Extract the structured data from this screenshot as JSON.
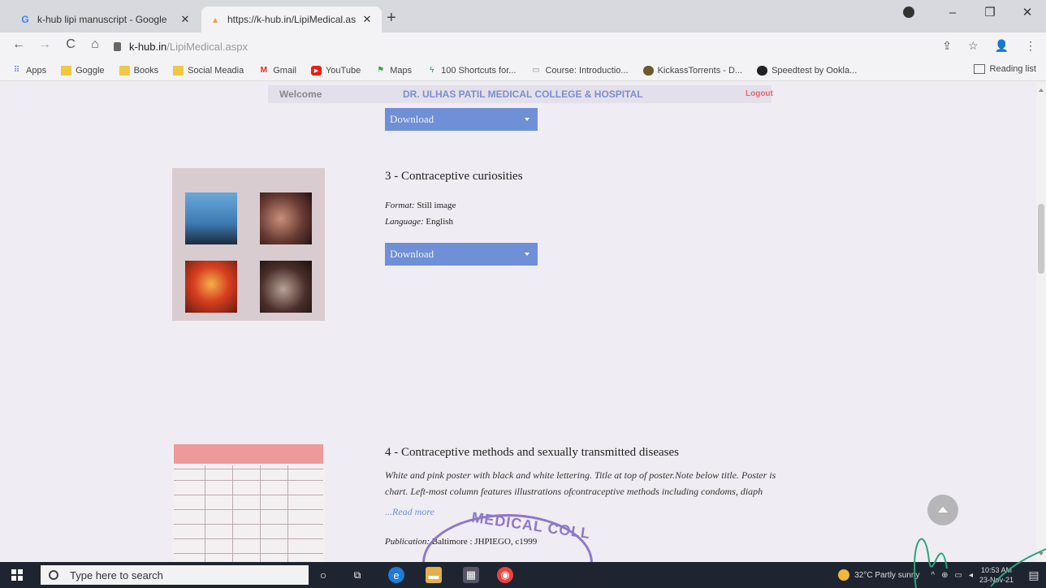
{
  "browser": {
    "tabs": [
      {
        "title": "k-hub lipi manuscript - Google",
        "close": "✕"
      },
      {
        "title": "https://k-hub.in/LipiMedical.aspx",
        "close": "✕"
      }
    ],
    "new_tab": "+",
    "window_controls": {
      "minimize": "–",
      "restore": "❐",
      "close": "✕"
    },
    "nav": {
      "back": "←",
      "forward": "→",
      "reload": "C",
      "home": "⌂"
    },
    "url_host": "k-hub.in",
    "url_path": "/LipiMedical.aspx",
    "toolbar_icons": {
      "share": "⇪",
      "star": "☆",
      "profile": "👤",
      "menu": "⋮"
    },
    "bookmarks": [
      {
        "label": "Apps"
      },
      {
        "label": "Goggle"
      },
      {
        "label": "Books"
      },
      {
        "label": "Social Meadia"
      },
      {
        "label": "Gmail"
      },
      {
        "label": "YouTube"
      },
      {
        "label": "Maps"
      },
      {
        "label": "100 Shortcuts for..."
      },
      {
        "label": "Course: Introductio..."
      },
      {
        "label": "KickassTorrents - D..."
      },
      {
        "label": "Speedtest by Ookla..."
      }
    ],
    "reading_list": "Reading list"
  },
  "site": {
    "welcome": "Welcome",
    "college": "DR. ULHAS PATIL MEDICAL COLLEGE & HOSPITAL",
    "logout": "Logout"
  },
  "download_label": "Download",
  "items": [
    {
      "title": "3 - Contraceptive curiosities",
      "format_label": "Format:",
      "format_value": "Still image",
      "language_label": "Language:",
      "language_value": "English"
    },
    {
      "title": "4 - Contraceptive methods and sexually transmitted diseases",
      "description_line1": "White and pink poster with black and white lettering. Title at top of poster.Note below title. Poster is",
      "description_line2": "chart. Left-most column features illustrations ofcontraceptive methods including condoms, diaph",
      "read_more": "...Read more",
      "publication_label": "Publication:",
      "publication_value": "Baltimore : JHPIEGO, c1999"
    }
  ],
  "stamp_text": "MEDICAL COLL",
  "taskbar": {
    "search_placeholder": "Type here to search",
    "weather": "32°C  Partly sunny",
    "time": "10:53 AM",
    "date": "23-Nov-21"
  }
}
